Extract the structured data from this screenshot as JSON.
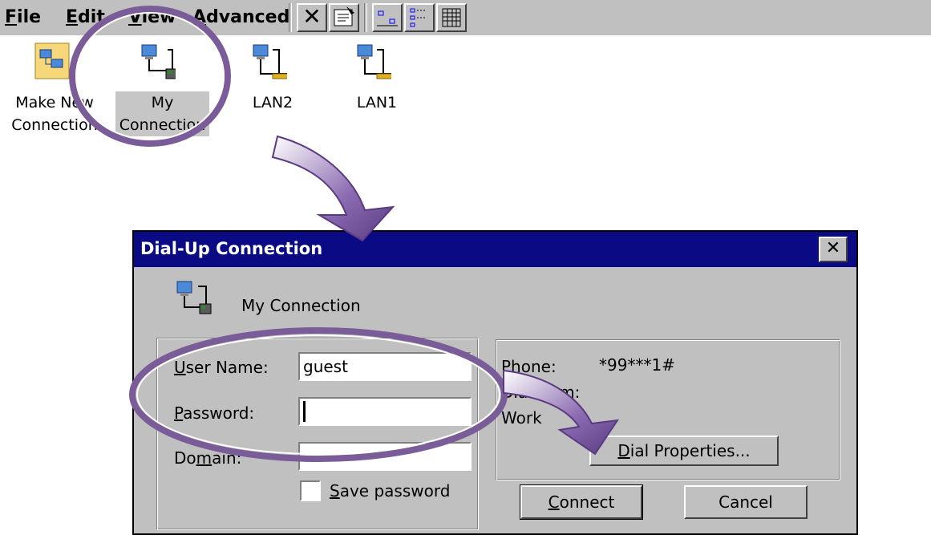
{
  "menubar": {
    "items": [
      {
        "accel": "F",
        "rest": "ile"
      },
      {
        "accel": "E",
        "rest": "dit"
      },
      {
        "accel": "V",
        "rest": "iew"
      },
      {
        "accel": "A",
        "rest": "dvanced"
      }
    ],
    "toolbar": {
      "delete_glyph": "✕"
    }
  },
  "desktop": {
    "icons": [
      {
        "line1": "Make New",
        "line2": "Connection"
      },
      {
        "line1": "My",
        "line2": "Connection"
      },
      {
        "line1": "LAN2",
        "line2": ""
      },
      {
        "line1": "LAN1",
        "line2": ""
      }
    ]
  },
  "dialog": {
    "title": "Dial-Up Connection",
    "close_glyph": "✕",
    "connection_name": "My Connection",
    "user_name_label_accel": "U",
    "user_name_label_rest": "ser Name:",
    "user_name_value": "guest",
    "password_label_accel": "P",
    "password_label_rest": "assword:",
    "password_value": "",
    "domain_label_pre": "Do",
    "domain_label_accel": "m",
    "domain_label_rest": "ain:",
    "domain_value": "",
    "save_password_accel": "S",
    "save_password_rest": "ave password",
    "phone_label": "Phone:",
    "phone_value": "*99***1#",
    "dial_from_label": "Dial from:",
    "dial_from_value": "Work",
    "dial_properties_accel": "D",
    "dial_properties_rest": "ial Properties...",
    "connect_accel": "C",
    "connect_rest": "onnect",
    "cancel_label": "Cancel"
  },
  "annotation": {
    "color": "#7a5c98"
  }
}
